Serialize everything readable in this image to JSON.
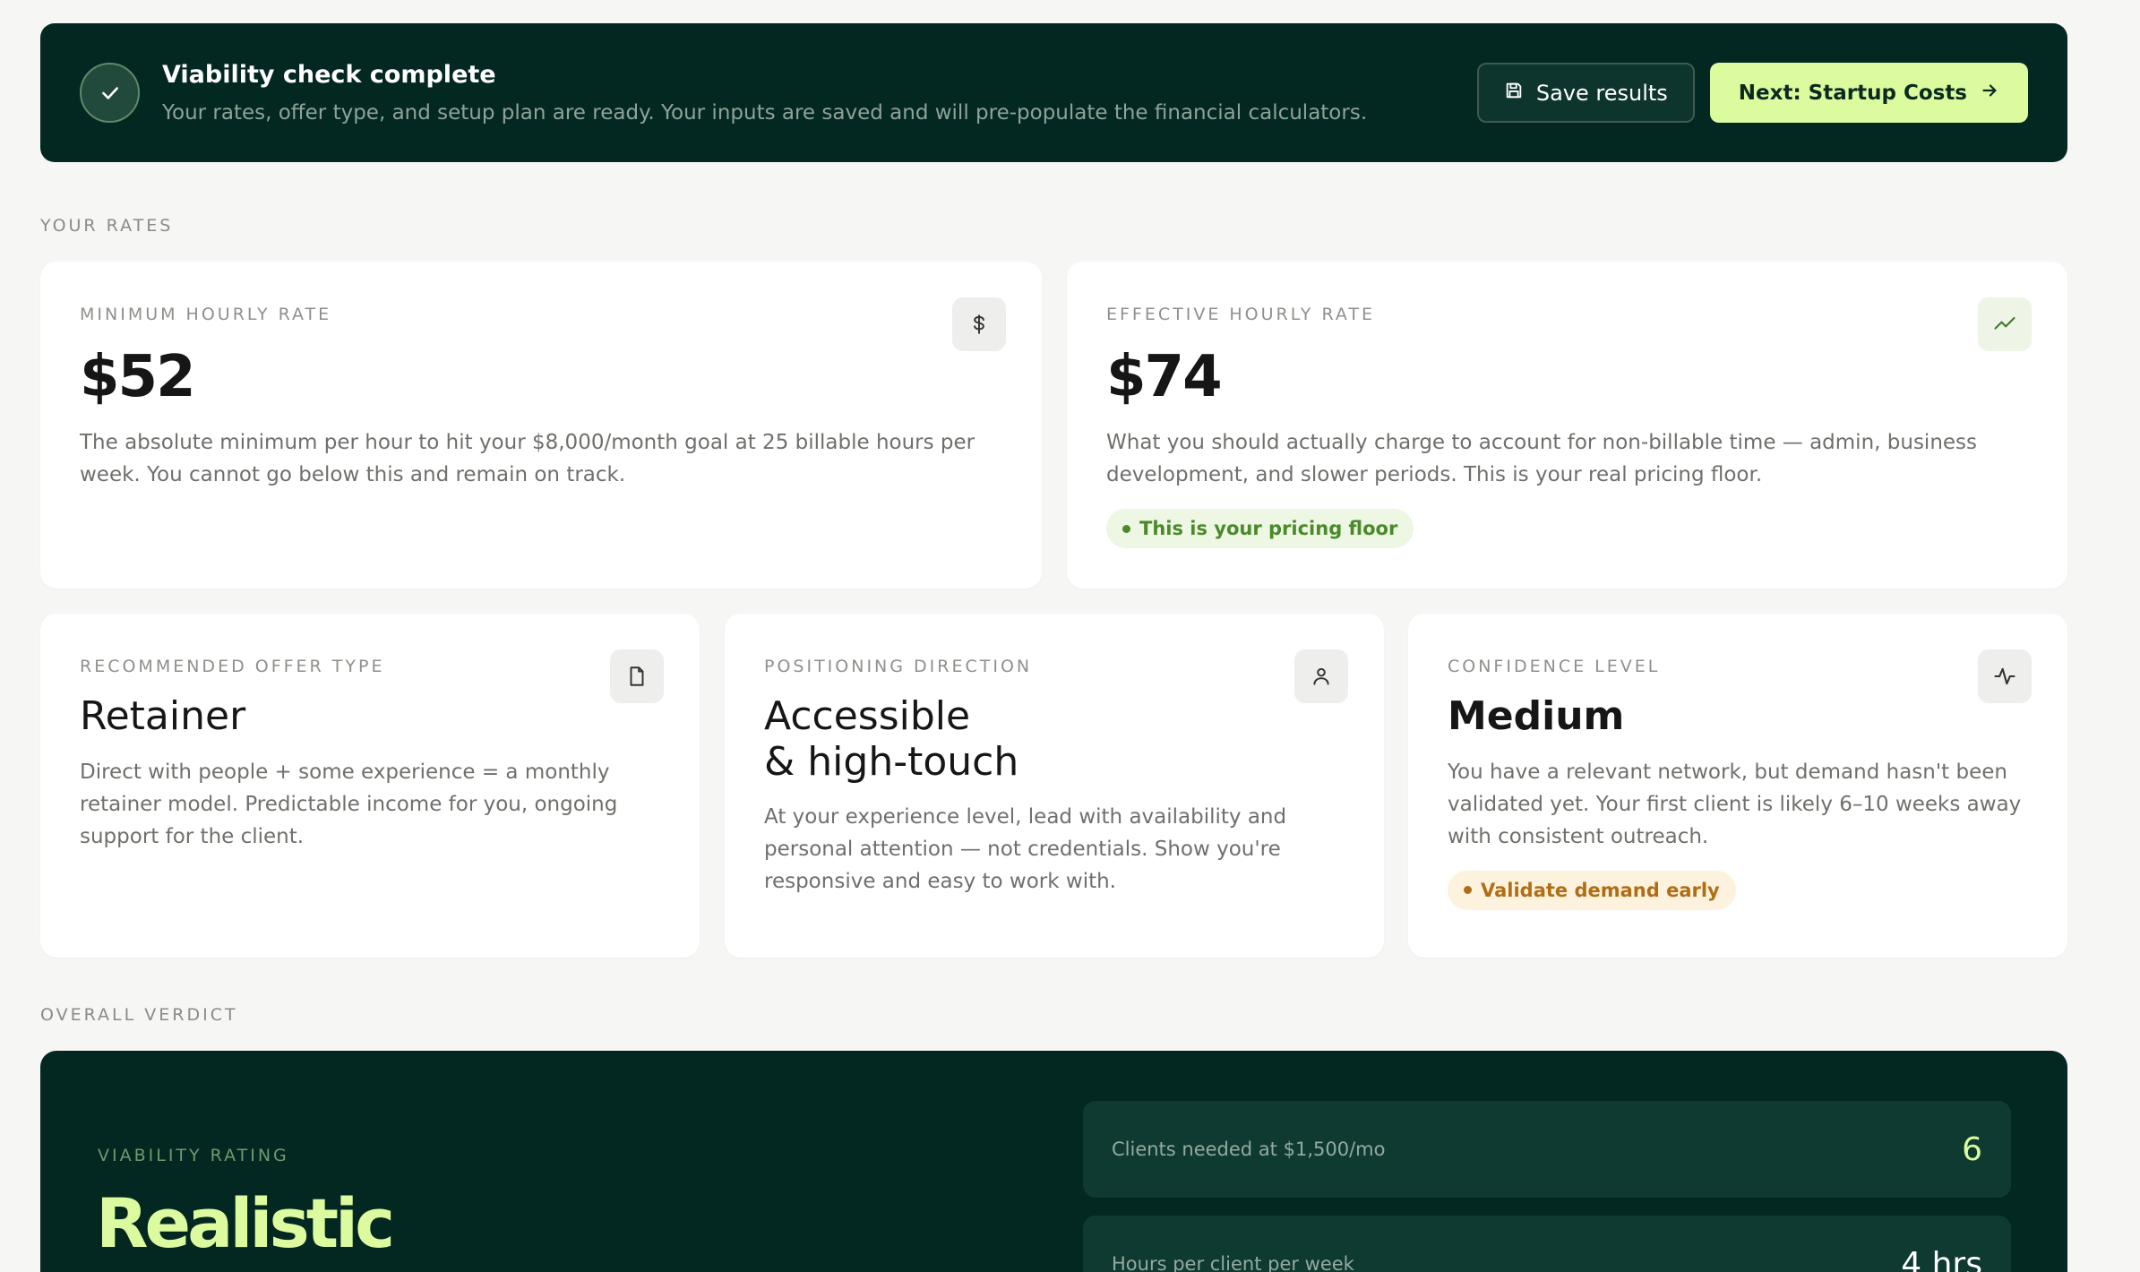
{
  "banner": {
    "title": "Viability check complete",
    "subtitle": "Your rates, offer type, and setup plan are ready. Your inputs are saved and will pre-populate the financial calculators.",
    "save_label": "Save results",
    "next_label": "Next: Startup Costs"
  },
  "rates_section": {
    "label": "YOUR RATES",
    "minimum": {
      "label": "MINIMUM HOURLY RATE",
      "value": "$52",
      "description": "The absolute minimum per hour to hit your $8,000/month goal at 25 billable hours per week. You cannot go below this and remain on track."
    },
    "effective": {
      "label": "EFFECTIVE HOURLY RATE",
      "value": "$74",
      "description": "What you should actually charge to account for non-billable time — admin, business development, and slower periods. This is your real pricing floor.",
      "badge": "This is your pricing floor"
    }
  },
  "insights": {
    "offer": {
      "label": "RECOMMENDED OFFER TYPE",
      "value": "Retainer",
      "description": "Direct with people + some experience = a monthly retainer model. Predictable income for you, ongoing support for the client."
    },
    "positioning": {
      "label": "POSITIONING DIRECTION",
      "value_line1": "Accessible",
      "value_line2": "& high-touch",
      "description": "At your experience level, lead with availability and personal attention — not credentials. Show you're responsive and easy to work with."
    },
    "confidence": {
      "label": "CONFIDENCE LEVEL",
      "value": "Medium",
      "description": "You have a relevant network, but demand hasn't been validated yet. Your first client is likely 6–10 weeks away with consistent outreach.",
      "badge": "Validate demand early"
    }
  },
  "verdict_section": {
    "label": "OVERALL VERDICT",
    "rating_label": "VIABILITY RATING",
    "rating": "Realistic",
    "stats": [
      {
        "label": "Clients needed at $1,500/mo",
        "value": "6"
      },
      {
        "label": "Hours per client per week",
        "value": "4 hrs"
      }
    ]
  },
  "colors": {
    "dark_green": "#032822",
    "lime_accent": "#dcfb9e",
    "success_green": "#4a8a2a",
    "warning_amber": "#b06e14"
  },
  "icons": {
    "banner": "check-icon",
    "save": "floppy-disk-icon",
    "next": "arrow-right-icon",
    "minimum": "dollar-icon",
    "effective": "trend-up-icon",
    "offer": "document-icon",
    "positioning": "user-icon",
    "confidence": "pulse-icon"
  }
}
